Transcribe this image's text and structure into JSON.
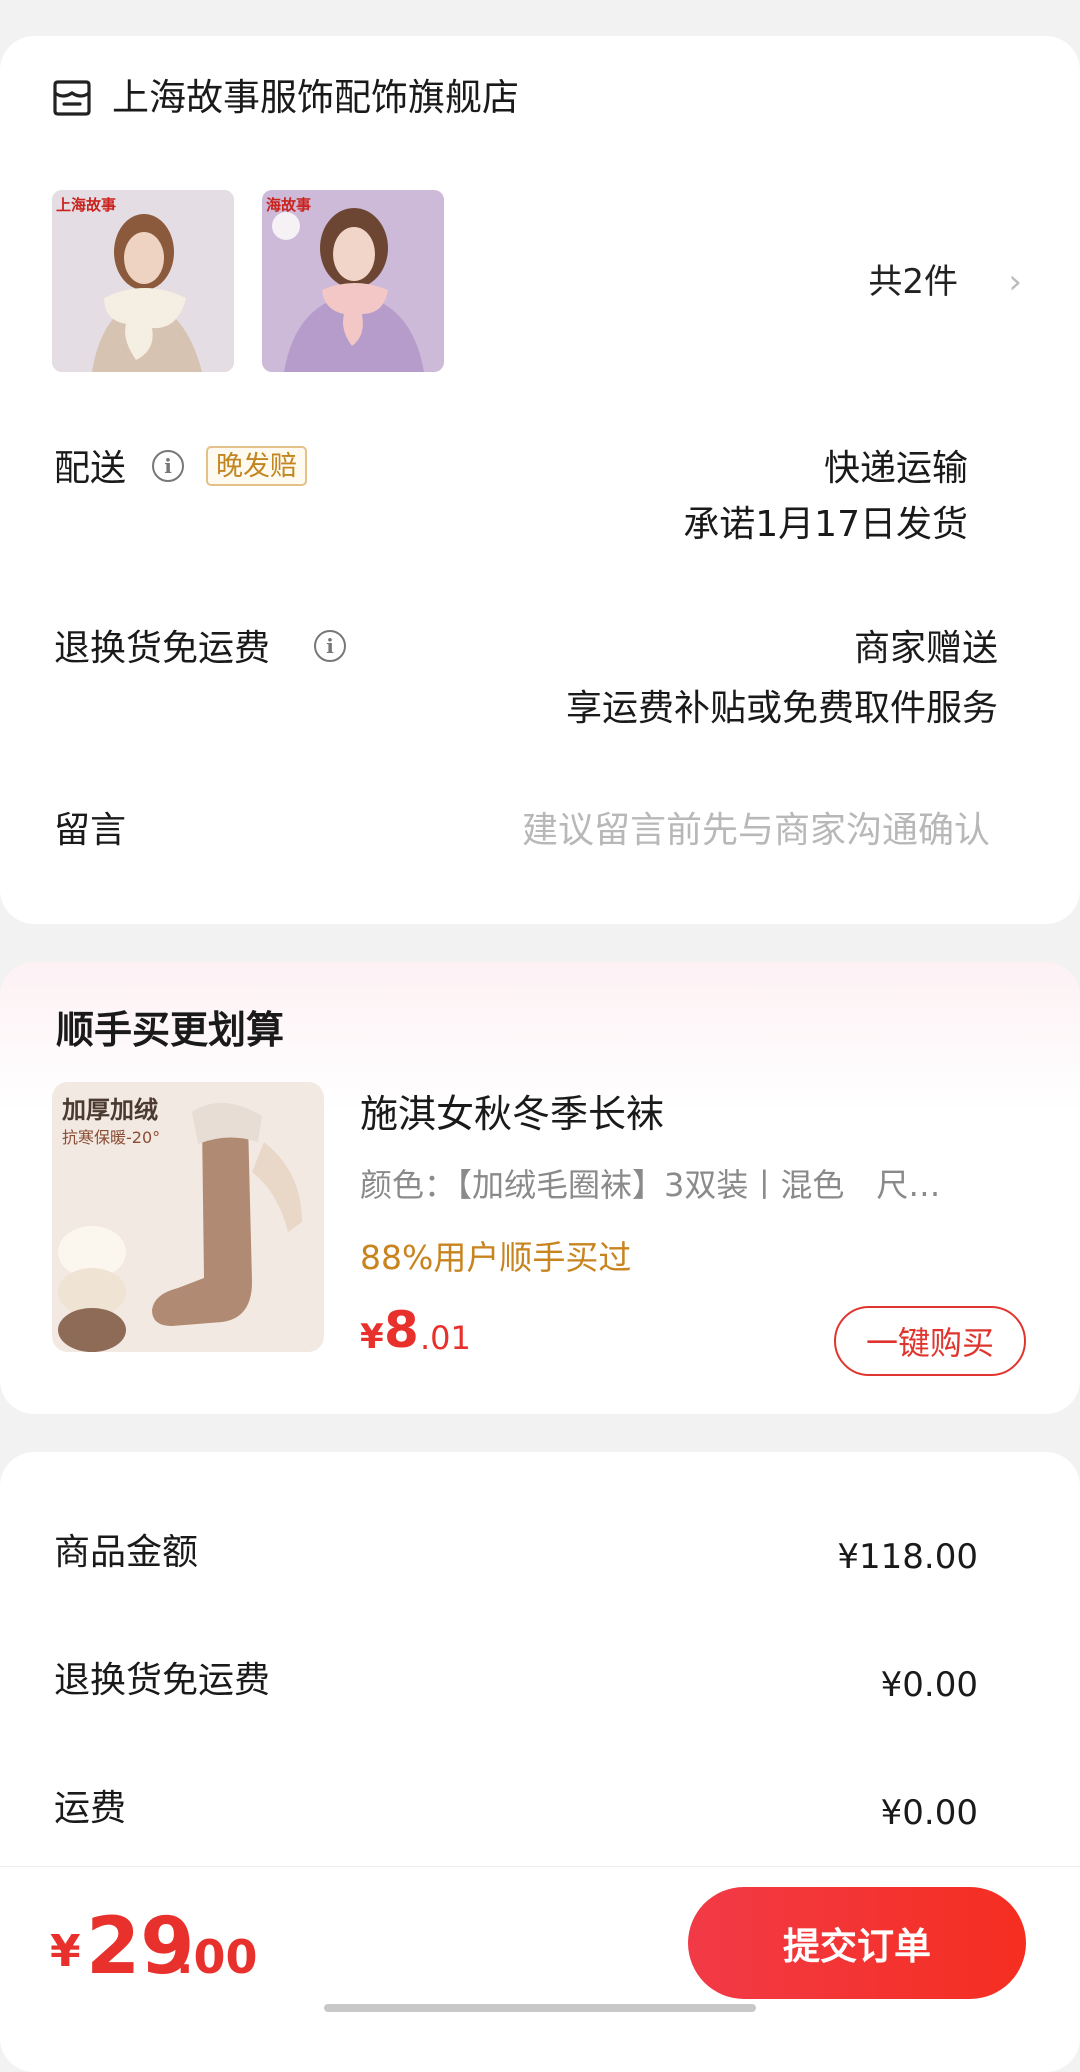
{
  "shop": {
    "store_name": "上海故事服饰配饰旗舰店",
    "item_images": [
      {
        "alt": "cream faux fur scarf",
        "brand": "上海故事"
      },
      {
        "alt": "pink faux fur scarf",
        "brand": "海故事"
      }
    ],
    "item_count": "共2件",
    "shipping": {
      "label": "配送",
      "badge": "晚发赔",
      "method": "快递运输",
      "promise": "承诺1月17日发货"
    },
    "return_shipping": {
      "label": "退换货免运费",
      "value": "商家赠送",
      "detail": "享运费补贴或免费取件服务"
    },
    "message": {
      "label": "留言",
      "placeholder": "建议留言前先与商家沟通确认"
    }
  },
  "addon": {
    "title": "顺手买更划算",
    "image_text_1": "加厚加绒",
    "image_text_2": "抗寒保暖-20°",
    "product_name": "施淇女秋冬季长袜",
    "spec": "颜色：【加绒毛圈袜】3双装丨混色　尺…",
    "social_proof": "88%用户顺手买过",
    "price_symbol": "¥",
    "price_integer": "8",
    "price_decimal": ".01",
    "buy_button": "一键购买"
  },
  "summary": {
    "rows": [
      {
        "label": "商品金额",
        "value": "¥118.00"
      },
      {
        "label": "退换货免运费",
        "value": "¥0.00"
      },
      {
        "label": "运费",
        "value": "¥0.00"
      }
    ]
  },
  "bottom_bar": {
    "total_symbol": "¥",
    "total_integer": "29",
    "total_decimal": ".00",
    "submit_label": "提交订单"
  },
  "colors": {
    "accent_red": "#e8302c",
    "orange_text": "#c7841f",
    "placeholder_gray": "#b8b8b8"
  }
}
